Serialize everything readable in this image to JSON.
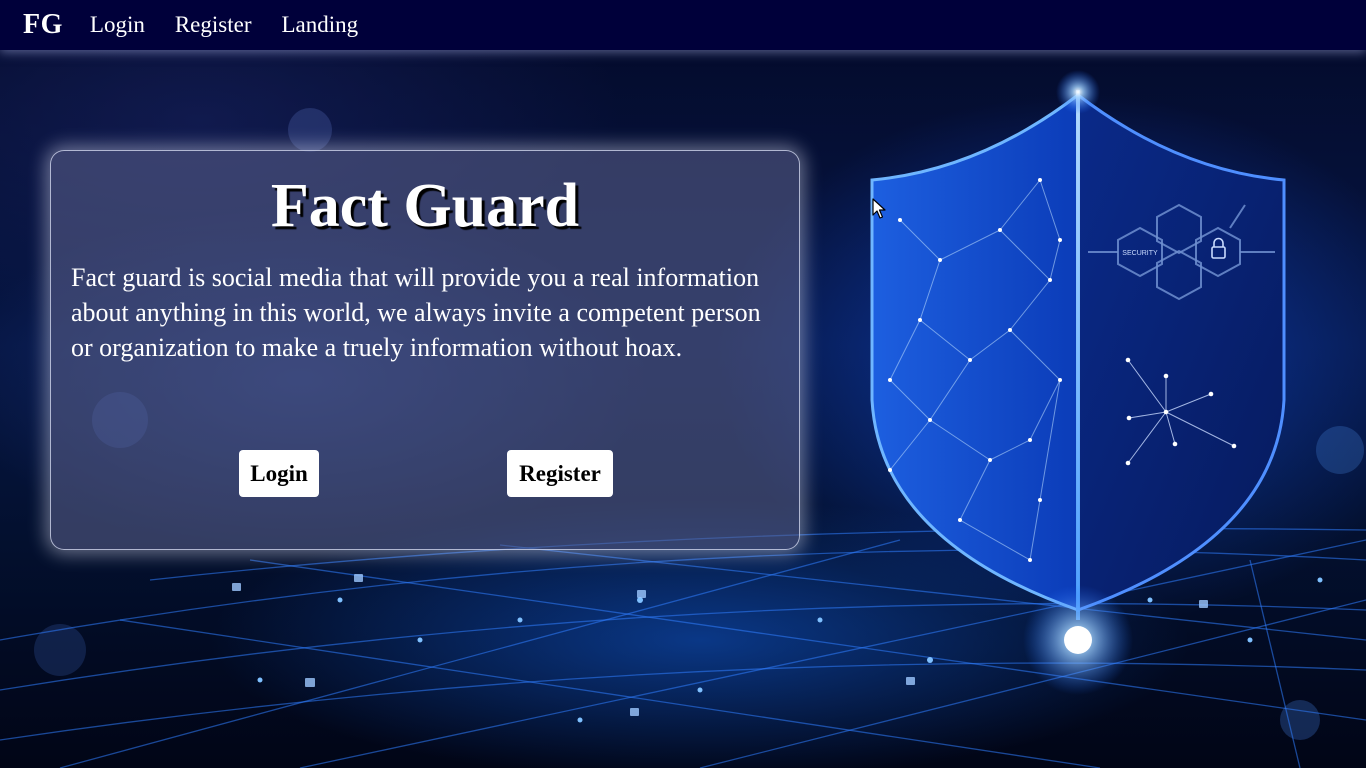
{
  "navbar": {
    "brand": "FG",
    "links": [
      "Login",
      "Register",
      "Landing"
    ]
  },
  "hero": {
    "title": "Fact Guard",
    "description": "Fact guard is social media that will provide you a real information about anything in this world, we always invite a competent person or organization to make a truely information without hoax.",
    "login_button": "Login",
    "register_button": "Register"
  },
  "background": {
    "shield_labels": [
      "SECURITY"
    ],
    "shield_icon": "padlock-icon"
  },
  "colors": {
    "navbar_bg": "#00003a",
    "accent_glow": "#2a7bff",
    "button_bg": "#ffffff",
    "text": "#ffffff"
  }
}
